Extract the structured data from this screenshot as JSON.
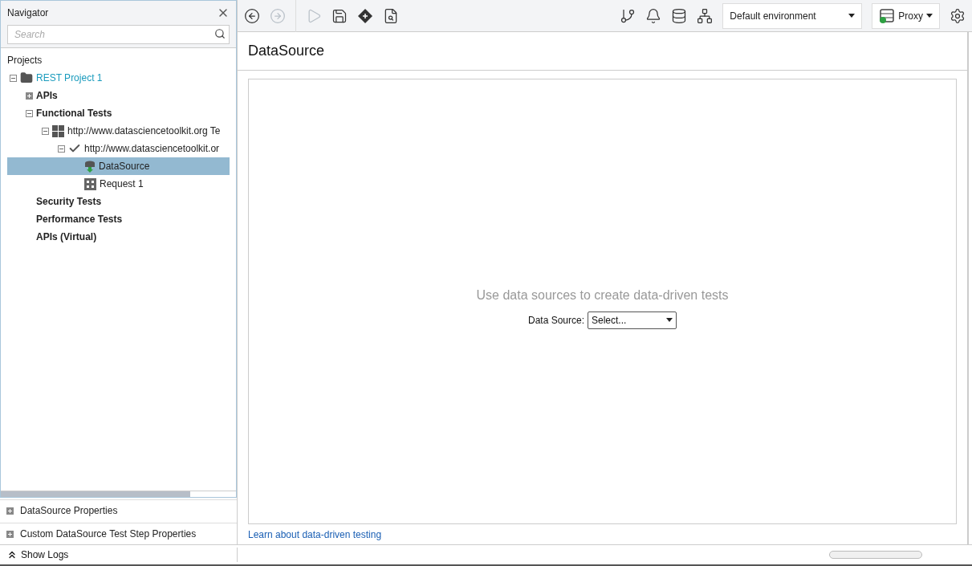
{
  "navigator": {
    "title": "Navigator",
    "search": {
      "placeholder": "Search"
    },
    "section": "Projects",
    "tree": [
      {
        "label": "REST Project 1",
        "kind": "project",
        "expanded": true,
        "selected": false,
        "children": [
          {
            "label": "APIs",
            "kind": "folder",
            "expanded": false,
            "selected": false
          },
          {
            "label": "Functional Tests",
            "kind": "folder",
            "expanded": true,
            "selected": false,
            "children": [
              {
                "label": "http://www.datasciencetoolkit.org Te",
                "kind": "testsuite",
                "expanded": true,
                "selected": false,
                "children": [
                  {
                    "label": "http://www.datasciencetoolkit.or",
                    "kind": "testcase",
                    "expanded": true,
                    "selected": false,
                    "children": [
                      {
                        "label": "DataSource",
                        "kind": "datasource",
                        "selected": true
                      },
                      {
                        "label": "Request 1",
                        "kind": "request",
                        "selected": false
                      }
                    ]
                  }
                ]
              }
            ]
          },
          {
            "label": "Security Tests",
            "kind": "folder",
            "selected": false
          },
          {
            "label": "Performance Tests",
            "kind": "folder",
            "selected": false
          },
          {
            "label": "APIs (Virtual)",
            "kind": "folder",
            "selected": false
          }
        ]
      }
    ]
  },
  "properties_panels": [
    {
      "label": "DataSource Properties",
      "expanded": false
    },
    {
      "label": "Custom DataSource Test Step Properties",
      "expanded": false
    }
  ],
  "toolbar_buttons": [
    {
      "kind": "back",
      "disabled": false
    },
    {
      "kind": "forward",
      "disabled": true
    },
    {
      "kind": "run",
      "disabled": true
    },
    {
      "kind": "save",
      "disabled": false
    },
    {
      "kind": "diamond",
      "disabled": false
    },
    {
      "kind": "inspect",
      "disabled": false
    }
  ],
  "environment": {
    "value": "Default environment"
  },
  "proxy": {
    "label": "Proxy",
    "enabled": true
  },
  "editor": {
    "title": "DataSource",
    "hint": "Use data sources to create data-driven tests",
    "field_label": "Data Source:",
    "select_value": "Select...",
    "link": "Learn about data-driven testing"
  },
  "status_bar": {
    "show_logs": "Show Logs",
    "progress": {
      "level": 0
    }
  }
}
